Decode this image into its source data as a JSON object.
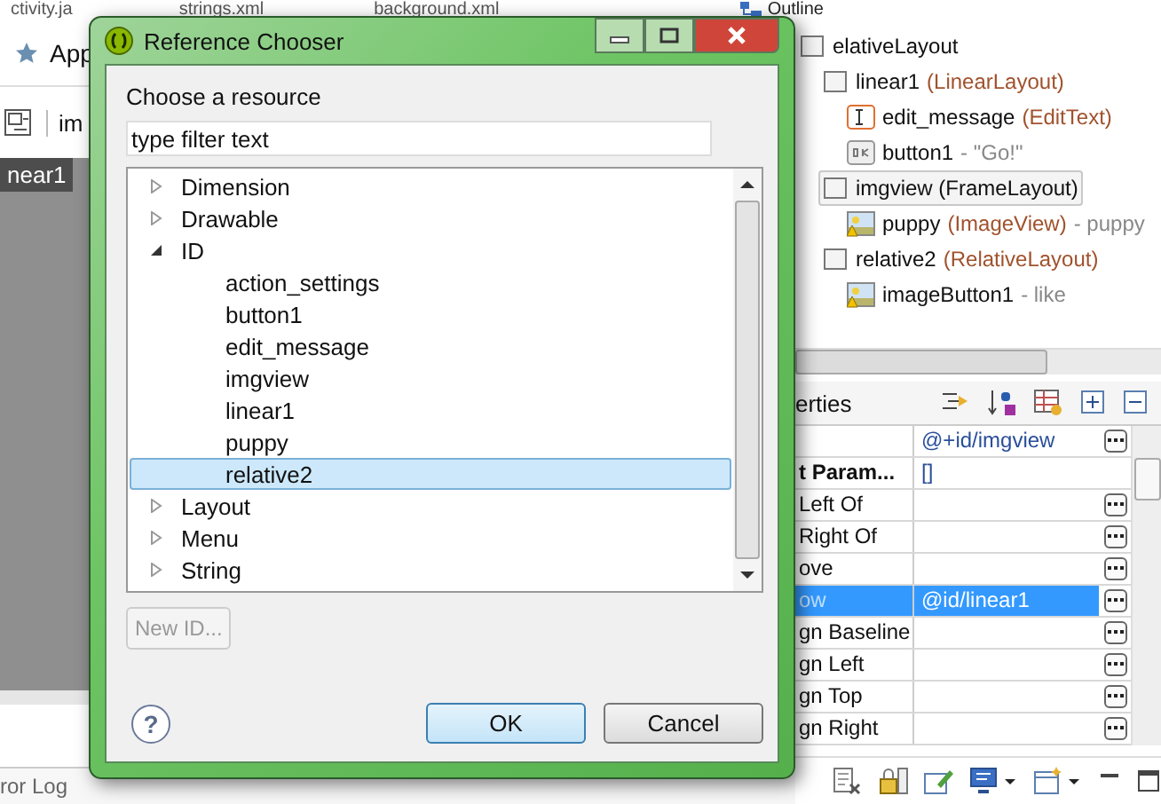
{
  "editor_tabs": [
    {
      "label": "ctivity.ja"
    },
    {
      "label": "strings.xml"
    },
    {
      "label": "background.xml"
    }
  ],
  "outline": {
    "title": "Outline",
    "tree": [
      {
        "name": "elativeLayout",
        "kind": "layout",
        "selected": false,
        "children": [
          {
            "name": "linear1",
            "type": "(LinearLayout)",
            "kind": "layout",
            "selected": false,
            "children": [
              {
                "name": "edit_message",
                "type": "(EditText)",
                "kind": "edittext",
                "selected": false
              },
              {
                "name": "button1",
                "detail": "- \"Go!\"",
                "kind": "button",
                "selected": false
              }
            ]
          },
          {
            "name": "imgview (FrameLayout)",
            "kind": "layout",
            "selected": true,
            "children": [
              {
                "name": "puppy",
                "type": "(ImageView)",
                "detail": "- puppy",
                "kind": "image",
                "selected": false
              }
            ]
          },
          {
            "name": "relative2",
            "type": "(RelativeLayout)",
            "kind": "layout",
            "selected": false,
            "children": [
              {
                "name": "imageButton1",
                "detail": "- like",
                "kind": "image",
                "selected": false
              }
            ]
          }
        ]
      }
    ]
  },
  "editor": {
    "title": "App",
    "toolbar_text": "im",
    "canvas_label": "near1",
    "bottom_tab": "ror Log"
  },
  "properties": {
    "title": "erties",
    "rows": [
      {
        "kind": "property",
        "value": "@+id/imgview",
        "selected": false
      },
      {
        "kind": "category",
        "name": "t Param...",
        "value": "[]",
        "selected": false
      },
      {
        "kind": "property",
        "name": "Left Of",
        "selected": false
      },
      {
        "kind": "property",
        "name": "Right Of",
        "selected": false
      },
      {
        "kind": "property",
        "name": "ove",
        "selected": false
      },
      {
        "kind": "property",
        "name": "ow",
        "value": "@id/linear1",
        "selected": true
      },
      {
        "kind": "property",
        "name": "gn Baseline",
        "selected": false
      },
      {
        "kind": "property",
        "name": "gn Left",
        "selected": false
      },
      {
        "kind": "property",
        "name": "gn Top",
        "selected": false
      },
      {
        "kind": "property",
        "name": "gn Right",
        "selected": false
      }
    ]
  },
  "dialog": {
    "title": "Reference Chooser",
    "prompt": "Choose a resource",
    "filter": {
      "value": "type filter text"
    },
    "tree": [
      {
        "label": "Dimension",
        "expanded": false,
        "selected": false
      },
      {
        "label": "Drawable",
        "expanded": false,
        "selected": false
      },
      {
        "label": "ID",
        "expanded": true,
        "selected": false,
        "children": [
          {
            "label": "action_settings",
            "selected": false
          },
          {
            "label": "button1",
            "selected": false
          },
          {
            "label": "edit_message",
            "selected": false
          },
          {
            "label": "imgview",
            "selected": false
          },
          {
            "label": "linear1",
            "selected": false
          },
          {
            "label": "puppy",
            "selected": false
          },
          {
            "label": "relative2",
            "selected": true
          }
        ]
      },
      {
        "label": "Layout",
        "expanded": false,
        "selected": false
      },
      {
        "label": "Menu",
        "expanded": false,
        "selected": false
      },
      {
        "label": "String",
        "expanded": false,
        "selected": false
      }
    ],
    "new_button": {
      "label": "New ID...",
      "disabled": true
    },
    "buttons": [
      {
        "label": "OK",
        "default": true
      },
      {
        "label": "Cancel",
        "default": false
      }
    ],
    "help_button": {
      "label": "?"
    }
  }
}
